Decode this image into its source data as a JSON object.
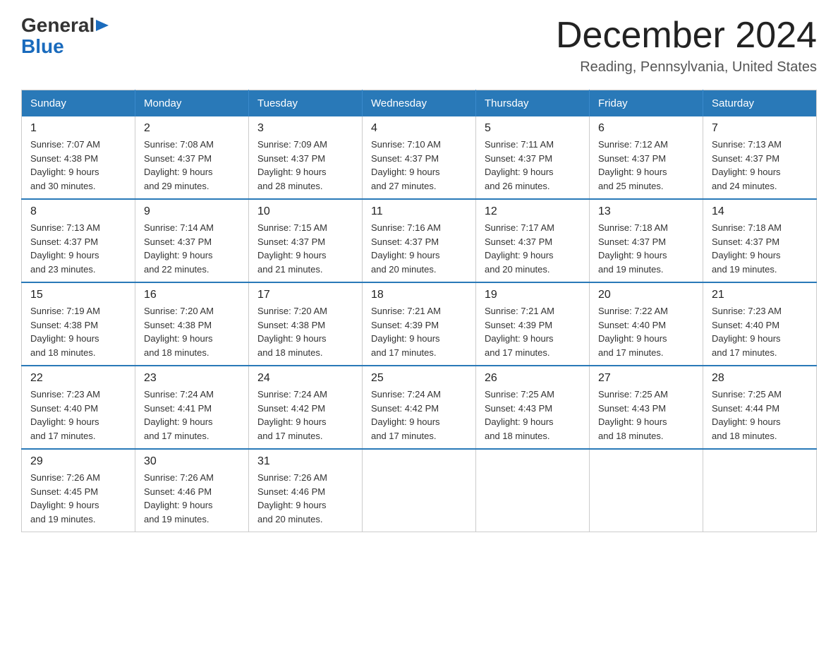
{
  "logo": {
    "general_text": "General",
    "blue_text": "Blue"
  },
  "header": {
    "month_year": "December 2024",
    "location": "Reading, Pennsylvania, United States"
  },
  "weekdays": [
    "Sunday",
    "Monday",
    "Tuesday",
    "Wednesday",
    "Thursday",
    "Friday",
    "Saturday"
  ],
  "weeks": [
    [
      {
        "day": "1",
        "sunrise": "7:07 AM",
        "sunset": "4:38 PM",
        "daylight": "9 hours and 30 minutes."
      },
      {
        "day": "2",
        "sunrise": "7:08 AM",
        "sunset": "4:37 PM",
        "daylight": "9 hours and 29 minutes."
      },
      {
        "day": "3",
        "sunrise": "7:09 AM",
        "sunset": "4:37 PM",
        "daylight": "9 hours and 28 minutes."
      },
      {
        "day": "4",
        "sunrise": "7:10 AM",
        "sunset": "4:37 PM",
        "daylight": "9 hours and 27 minutes."
      },
      {
        "day": "5",
        "sunrise": "7:11 AM",
        "sunset": "4:37 PM",
        "daylight": "9 hours and 26 minutes."
      },
      {
        "day": "6",
        "sunrise": "7:12 AM",
        "sunset": "4:37 PM",
        "daylight": "9 hours and 25 minutes."
      },
      {
        "day": "7",
        "sunrise": "7:13 AM",
        "sunset": "4:37 PM",
        "daylight": "9 hours and 24 minutes."
      }
    ],
    [
      {
        "day": "8",
        "sunrise": "7:13 AM",
        "sunset": "4:37 PM",
        "daylight": "9 hours and 23 minutes."
      },
      {
        "day": "9",
        "sunrise": "7:14 AM",
        "sunset": "4:37 PM",
        "daylight": "9 hours and 22 minutes."
      },
      {
        "day": "10",
        "sunrise": "7:15 AM",
        "sunset": "4:37 PM",
        "daylight": "9 hours and 21 minutes."
      },
      {
        "day": "11",
        "sunrise": "7:16 AM",
        "sunset": "4:37 PM",
        "daylight": "9 hours and 20 minutes."
      },
      {
        "day": "12",
        "sunrise": "7:17 AM",
        "sunset": "4:37 PM",
        "daylight": "9 hours and 20 minutes."
      },
      {
        "day": "13",
        "sunrise": "7:18 AM",
        "sunset": "4:37 PM",
        "daylight": "9 hours and 19 minutes."
      },
      {
        "day": "14",
        "sunrise": "7:18 AM",
        "sunset": "4:37 PM",
        "daylight": "9 hours and 19 minutes."
      }
    ],
    [
      {
        "day": "15",
        "sunrise": "7:19 AM",
        "sunset": "4:38 PM",
        "daylight": "9 hours and 18 minutes."
      },
      {
        "day": "16",
        "sunrise": "7:20 AM",
        "sunset": "4:38 PM",
        "daylight": "9 hours and 18 minutes."
      },
      {
        "day": "17",
        "sunrise": "7:20 AM",
        "sunset": "4:38 PM",
        "daylight": "9 hours and 18 minutes."
      },
      {
        "day": "18",
        "sunrise": "7:21 AM",
        "sunset": "4:39 PM",
        "daylight": "9 hours and 17 minutes."
      },
      {
        "day": "19",
        "sunrise": "7:21 AM",
        "sunset": "4:39 PM",
        "daylight": "9 hours and 17 minutes."
      },
      {
        "day": "20",
        "sunrise": "7:22 AM",
        "sunset": "4:40 PM",
        "daylight": "9 hours and 17 minutes."
      },
      {
        "day": "21",
        "sunrise": "7:23 AM",
        "sunset": "4:40 PM",
        "daylight": "9 hours and 17 minutes."
      }
    ],
    [
      {
        "day": "22",
        "sunrise": "7:23 AM",
        "sunset": "4:40 PM",
        "daylight": "9 hours and 17 minutes."
      },
      {
        "day": "23",
        "sunrise": "7:24 AM",
        "sunset": "4:41 PM",
        "daylight": "9 hours and 17 minutes."
      },
      {
        "day": "24",
        "sunrise": "7:24 AM",
        "sunset": "4:42 PM",
        "daylight": "9 hours and 17 minutes."
      },
      {
        "day": "25",
        "sunrise": "7:24 AM",
        "sunset": "4:42 PM",
        "daylight": "9 hours and 17 minutes."
      },
      {
        "day": "26",
        "sunrise": "7:25 AM",
        "sunset": "4:43 PM",
        "daylight": "9 hours and 18 minutes."
      },
      {
        "day": "27",
        "sunrise": "7:25 AM",
        "sunset": "4:43 PM",
        "daylight": "9 hours and 18 minutes."
      },
      {
        "day": "28",
        "sunrise": "7:25 AM",
        "sunset": "4:44 PM",
        "daylight": "9 hours and 18 minutes."
      }
    ],
    [
      {
        "day": "29",
        "sunrise": "7:26 AM",
        "sunset": "4:45 PM",
        "daylight": "9 hours and 19 minutes."
      },
      {
        "day": "30",
        "sunrise": "7:26 AM",
        "sunset": "4:46 PM",
        "daylight": "9 hours and 19 minutes."
      },
      {
        "day": "31",
        "sunrise": "7:26 AM",
        "sunset": "4:46 PM",
        "daylight": "9 hours and 20 minutes."
      },
      null,
      null,
      null,
      null
    ]
  ],
  "labels": {
    "sunrise": "Sunrise:",
    "sunset": "Sunset:",
    "daylight": "Daylight:"
  }
}
